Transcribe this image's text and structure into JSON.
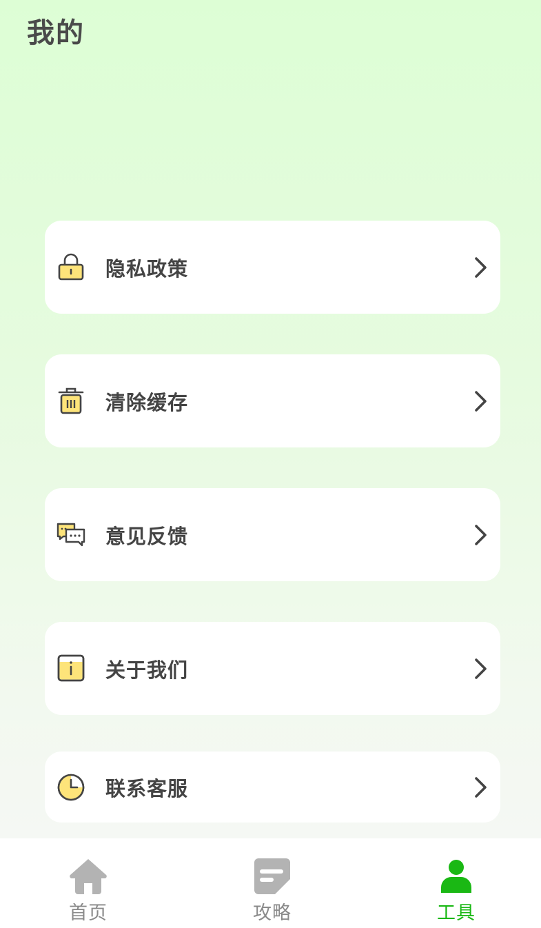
{
  "header": {
    "title": "我的"
  },
  "menu": {
    "items": [
      {
        "id": "privacy",
        "label": "隐私政策",
        "icon": "lock-icon"
      },
      {
        "id": "cache",
        "label": "清除缓存",
        "icon": "trash-icon"
      },
      {
        "id": "feedback",
        "label": "意见反馈",
        "icon": "chat-bubbles-icon"
      },
      {
        "id": "about",
        "label": "关于我们",
        "icon": "info-icon"
      },
      {
        "id": "service",
        "label": "联系客服",
        "icon": "clock-icon"
      }
    ]
  },
  "tabbar": {
    "tabs": [
      {
        "label": "首页",
        "icon": "home-icon",
        "active": false
      },
      {
        "label": "攻略",
        "icon": "document-icon",
        "active": false
      },
      {
        "label": "工具",
        "icon": "person-icon",
        "active": true
      }
    ]
  },
  "colors": {
    "accent": "#1ab814",
    "icon_fill": "#fde47a",
    "icon_stroke": "#444444",
    "tab_inactive": "#b3b3b3"
  }
}
